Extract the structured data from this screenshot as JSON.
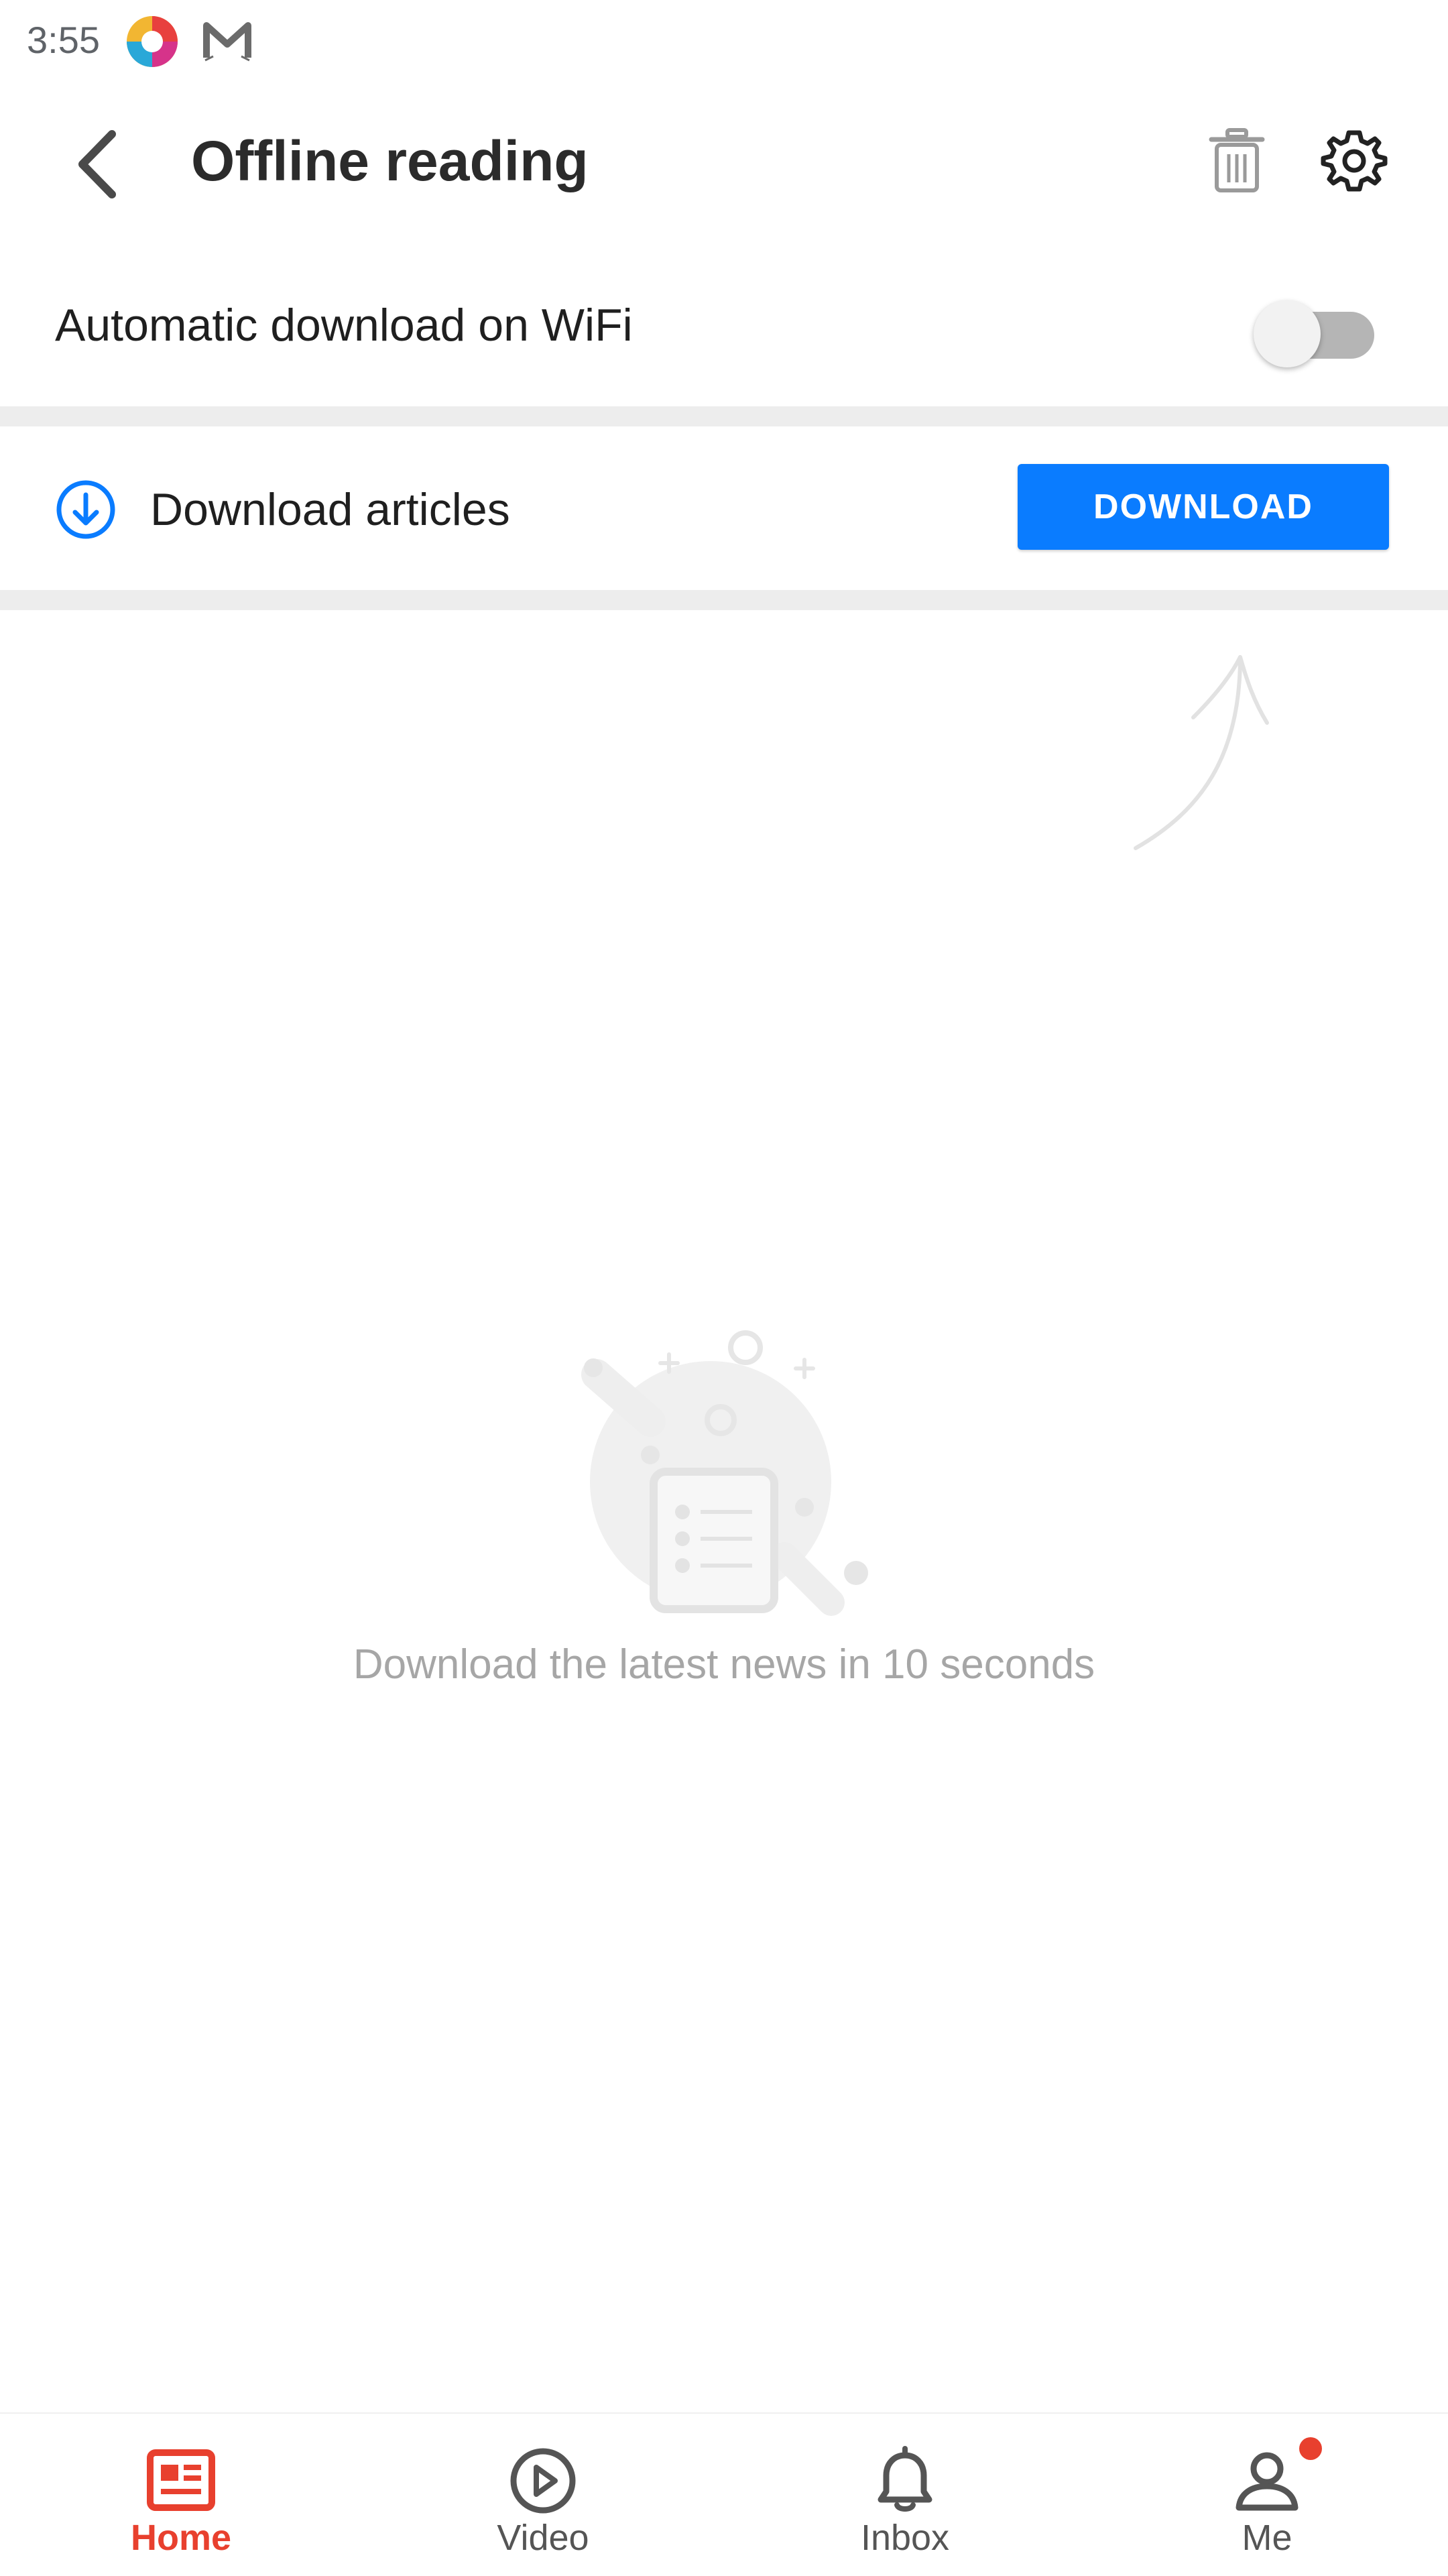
{
  "status_bar": {
    "time": "3:55",
    "icons": [
      "colorful-app-icon",
      "mail-app-icon"
    ]
  },
  "header": {
    "title": "Offline reading",
    "back_icon": "chevron-left-icon",
    "delete_icon": "trash-icon",
    "settings_icon": "gear-icon"
  },
  "auto_download": {
    "label": "Automatic download on WiFi",
    "enabled": false
  },
  "download_articles": {
    "label": "Download articles",
    "button_label": "DOWNLOAD",
    "icon": "download-circle-icon"
  },
  "empty_state": {
    "message": "Download the latest news in 10 seconds",
    "illustration": "news-document-illustration"
  },
  "bottom_nav": {
    "items": [
      {
        "label": "Home",
        "icon": "news-icon",
        "active": true
      },
      {
        "label": "Video",
        "icon": "play-circle-icon",
        "active": false
      },
      {
        "label": "Inbox",
        "icon": "bell-icon",
        "active": false
      },
      {
        "label": "Me",
        "icon": "person-icon",
        "active": false,
        "badge": true
      }
    ]
  },
  "colors": {
    "accent_blue": "#0a7cff",
    "brand_red": "#e8402e",
    "divider": "#ededed",
    "muted_text": "#a6a6a6"
  }
}
